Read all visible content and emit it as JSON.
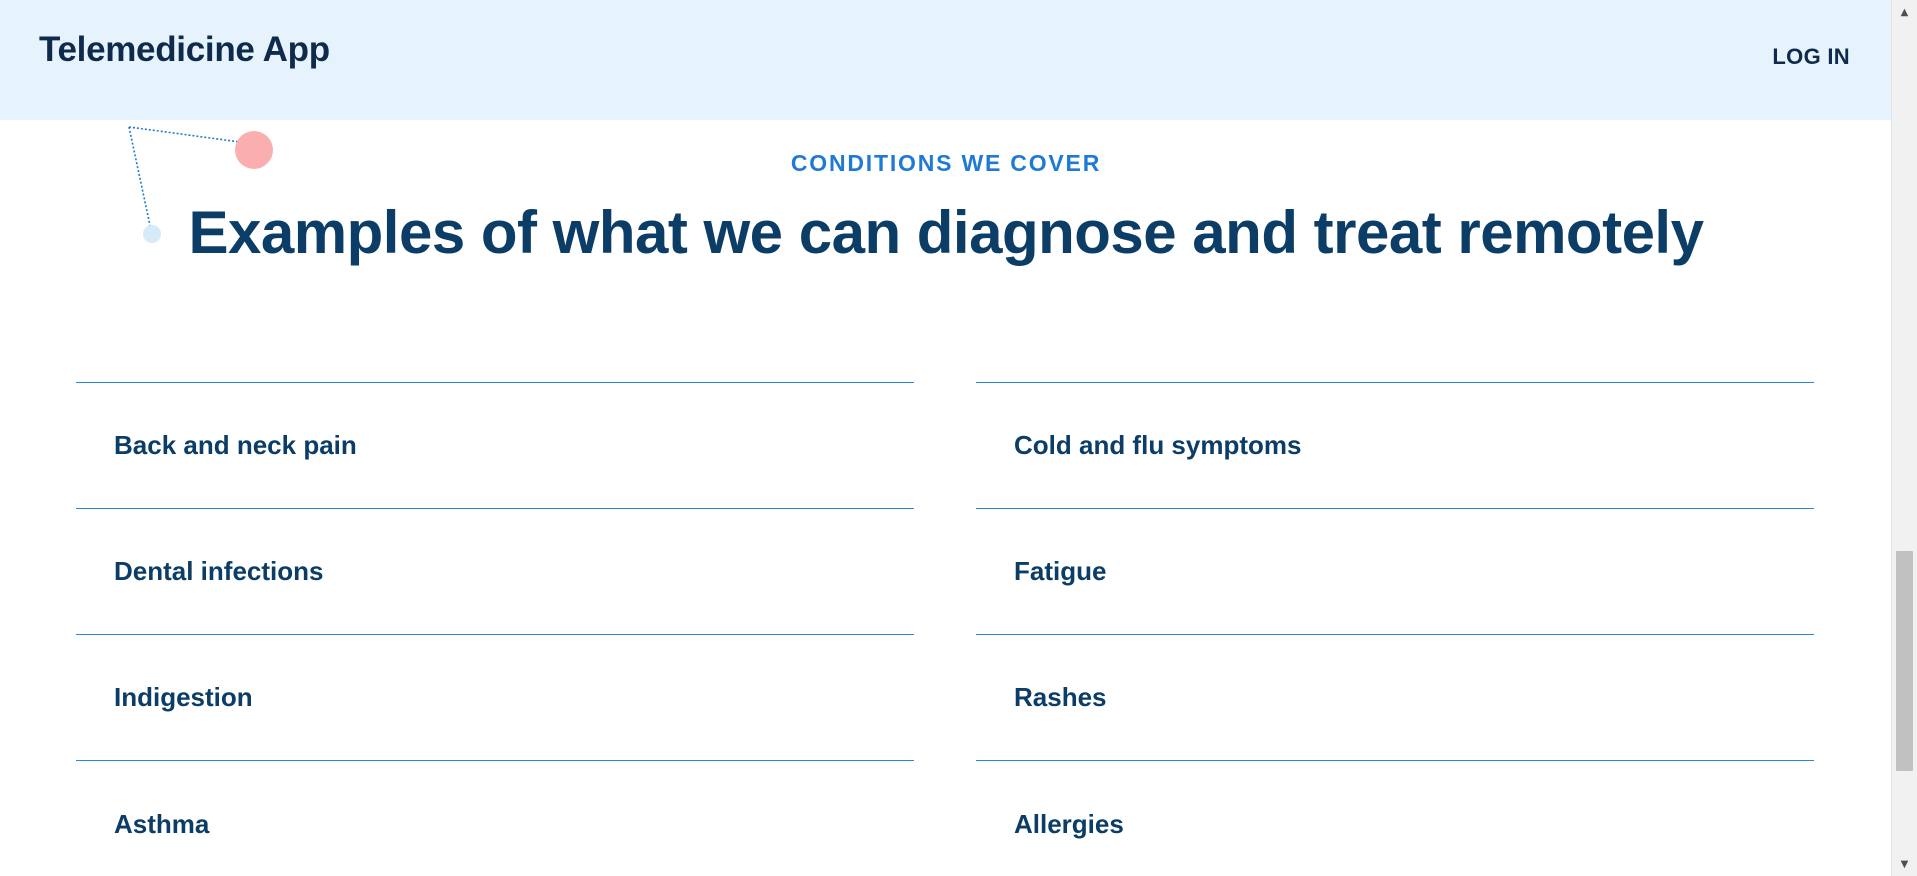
{
  "header": {
    "brand": "Telemedicine App",
    "login_label": "LOG IN",
    "background_color": "#e6f3fc"
  },
  "section": {
    "eyebrow": "CONDITIONS WE COVER",
    "heading": "Examples of what we can diagnose and treat remotely",
    "accent_color": "#1f7ad6",
    "heading_color": "#0b3d66"
  },
  "conditions": {
    "left": [
      {
        "label": "Back and neck pain"
      },
      {
        "label": "Dental infections"
      },
      {
        "label": "Indigestion"
      },
      {
        "label": "Asthma"
      }
    ],
    "right": [
      {
        "label": "Cold and flu symptoms"
      },
      {
        "label": "Fatigue"
      },
      {
        "label": "Rashes"
      },
      {
        "label": "Allergies"
      }
    ]
  },
  "decoration": {
    "dot_large_color": "#fbaeae",
    "dot_small_color": "#d6eaf8",
    "line_color": "#1f7ad6"
  },
  "scrollbar": {
    "up_icon": "arrow-up-icon",
    "down_icon": "arrow-down-icon"
  }
}
